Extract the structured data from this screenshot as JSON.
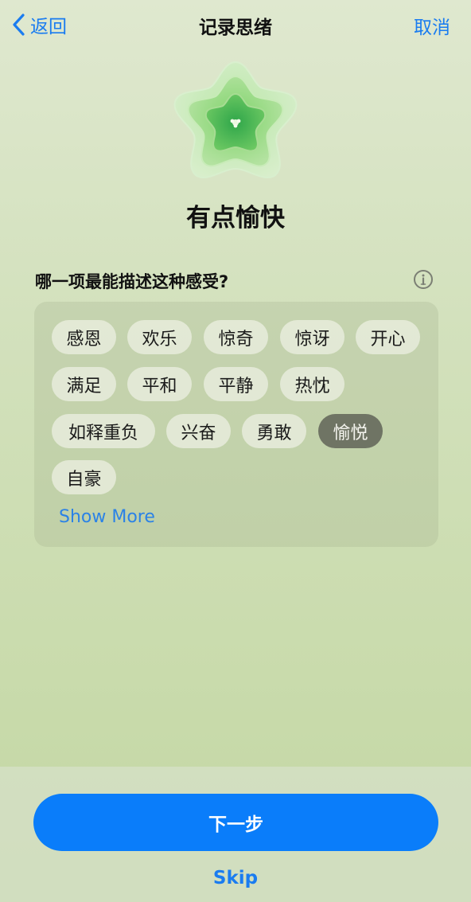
{
  "nav": {
    "back_label": "返回",
    "title": "记录思绪",
    "cancel_label": "取消"
  },
  "mood": {
    "title": "有点愉快"
  },
  "question": {
    "text": "哪一项最能描述这种感受?"
  },
  "emotions": [
    {
      "label": "感恩",
      "selected": false
    },
    {
      "label": "欢乐",
      "selected": false
    },
    {
      "label": "惊奇",
      "selected": false
    },
    {
      "label": "惊讶",
      "selected": false
    },
    {
      "label": "开心",
      "selected": false
    },
    {
      "label": "满足",
      "selected": false
    },
    {
      "label": "平和",
      "selected": false
    },
    {
      "label": "平静",
      "selected": false
    },
    {
      "label": "热忱",
      "selected": false
    },
    {
      "label": "如释重负",
      "selected": false
    },
    {
      "label": "兴奋",
      "selected": false
    },
    {
      "label": "勇敢",
      "selected": false
    },
    {
      "label": "愉悦",
      "selected": true
    },
    {
      "label": "自豪",
      "selected": false
    }
  ],
  "show_more_label": "Show More",
  "footer": {
    "next_label": "下一步",
    "skip_label": "Skip"
  },
  "colors": {
    "accent": "#0a7dfa",
    "link": "#1a7cf0",
    "selected_chip": "#6f7464"
  }
}
